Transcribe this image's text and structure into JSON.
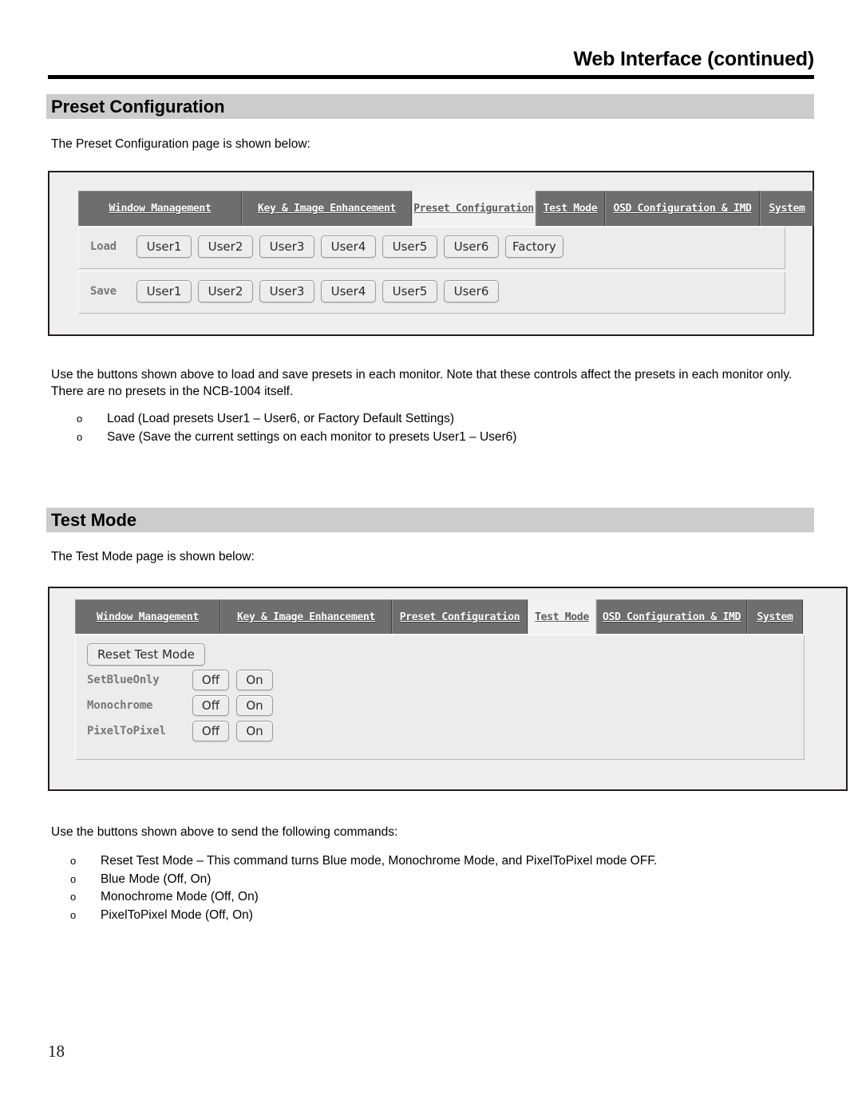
{
  "document": {
    "running_header": "Web Interface (continued)",
    "page_number": "18"
  },
  "sections": {
    "preset": {
      "heading": "Preset Configuration",
      "intro": "The Preset Configuration page is shown below:",
      "body": "Use the buttons shown above to load and save presets in each monitor. Note that these controls affect the presets in each monitor only. There are no presets in the NCB-1004 itself.",
      "bullets": [
        {
          "marker": "o",
          "text": "Load (Load presets User1 – User6, or Factory Default Settings)"
        },
        {
          "marker": "o",
          "text": "Save (Save the current settings on each monitor to presets User1 – User6)"
        }
      ]
    },
    "test_mode": {
      "heading": "Test Mode",
      "intro": "The Test Mode page is shown below:",
      "body": "Use the buttons shown above to send the following commands:",
      "bullets": [
        {
          "marker": "o",
          "text": "Reset Test Mode – This command turns Blue mode, Monochrome Mode, and PixelToPixel mode OFF."
        },
        {
          "marker": "o",
          "text": "Blue Mode (Off, On)"
        },
        {
          "marker": "o",
          "text": "Monochrome Mode (Off, On)"
        },
        {
          "marker": "o",
          "text": "PixelToPixel Mode (Off, On)"
        }
      ]
    }
  },
  "screenshot_preset": {
    "tabs": [
      {
        "label": "Window Management",
        "active": false
      },
      {
        "label": "Key & Image Enhancement",
        "active": false
      },
      {
        "label": "Preset Configuration",
        "active": true
      },
      {
        "label": "Test Mode",
        "active": false
      },
      {
        "label": "OSD Configuration & IMD",
        "active": false
      },
      {
        "label": "System",
        "active": false
      }
    ],
    "load_row": {
      "label": "Load",
      "buttons": [
        "User1",
        "User2",
        "User3",
        "User4",
        "User5",
        "User6",
        "Factory"
      ]
    },
    "save_row": {
      "label": "Save",
      "buttons": [
        "User1",
        "User2",
        "User3",
        "User4",
        "User5",
        "User6"
      ]
    }
  },
  "screenshot_test": {
    "tabs": [
      {
        "label": "Window Management",
        "active": false
      },
      {
        "label": "Key & Image Enhancement",
        "active": false
      },
      {
        "label": "Preset Configuration",
        "active": false
      },
      {
        "label": "Test Mode",
        "active": true
      },
      {
        "label": "OSD Configuration & IMD",
        "active": false
      },
      {
        "label": "System",
        "active": false
      }
    ],
    "reset_button": "Reset Test Mode",
    "rows": [
      {
        "label": "SetBlueOnly",
        "off": "Off",
        "on": "On"
      },
      {
        "label": "Monochrome",
        "off": "Off",
        "on": "On"
      },
      {
        "label": "PixelToPixel",
        "off": "Off",
        "on": "On"
      }
    ]
  },
  "colors": {
    "tab_inactive_bg": "#6e6e6e",
    "tab_active_bg": "#f2f2f2",
    "section_bar_bg": "#cccccc",
    "panel_bg": "#ececec",
    "button_bg": "#ededed",
    "rule": "#000000"
  }
}
